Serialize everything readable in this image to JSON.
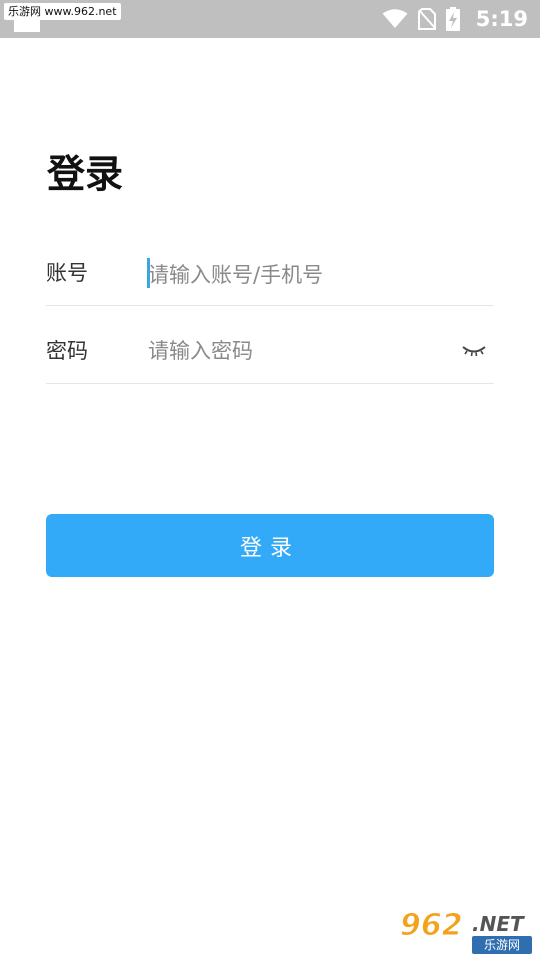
{
  "status_bar": {
    "watermark": "乐游网 www.962.net",
    "time": "5:19",
    "icons": [
      "wifi-icon",
      "no-sim-icon",
      "battery-charging-icon"
    ]
  },
  "page": {
    "title": "登录"
  },
  "form": {
    "account": {
      "label": "账号",
      "placeholder": "请输入账号/手机号"
    },
    "password": {
      "label": "密码",
      "placeholder": "请输入密码",
      "toggle_icon": "eye-closed-icon"
    }
  },
  "login_button": {
    "label": "登录"
  },
  "watermark_bottom": {
    "number": "962",
    "suffix": ".NET",
    "site": "乐游网"
  },
  "colors": {
    "primary": "#33aaf7",
    "status_bar": "#bfbfbf",
    "cursor": "#3aa6e0",
    "divider": "#e6e6e6"
  }
}
